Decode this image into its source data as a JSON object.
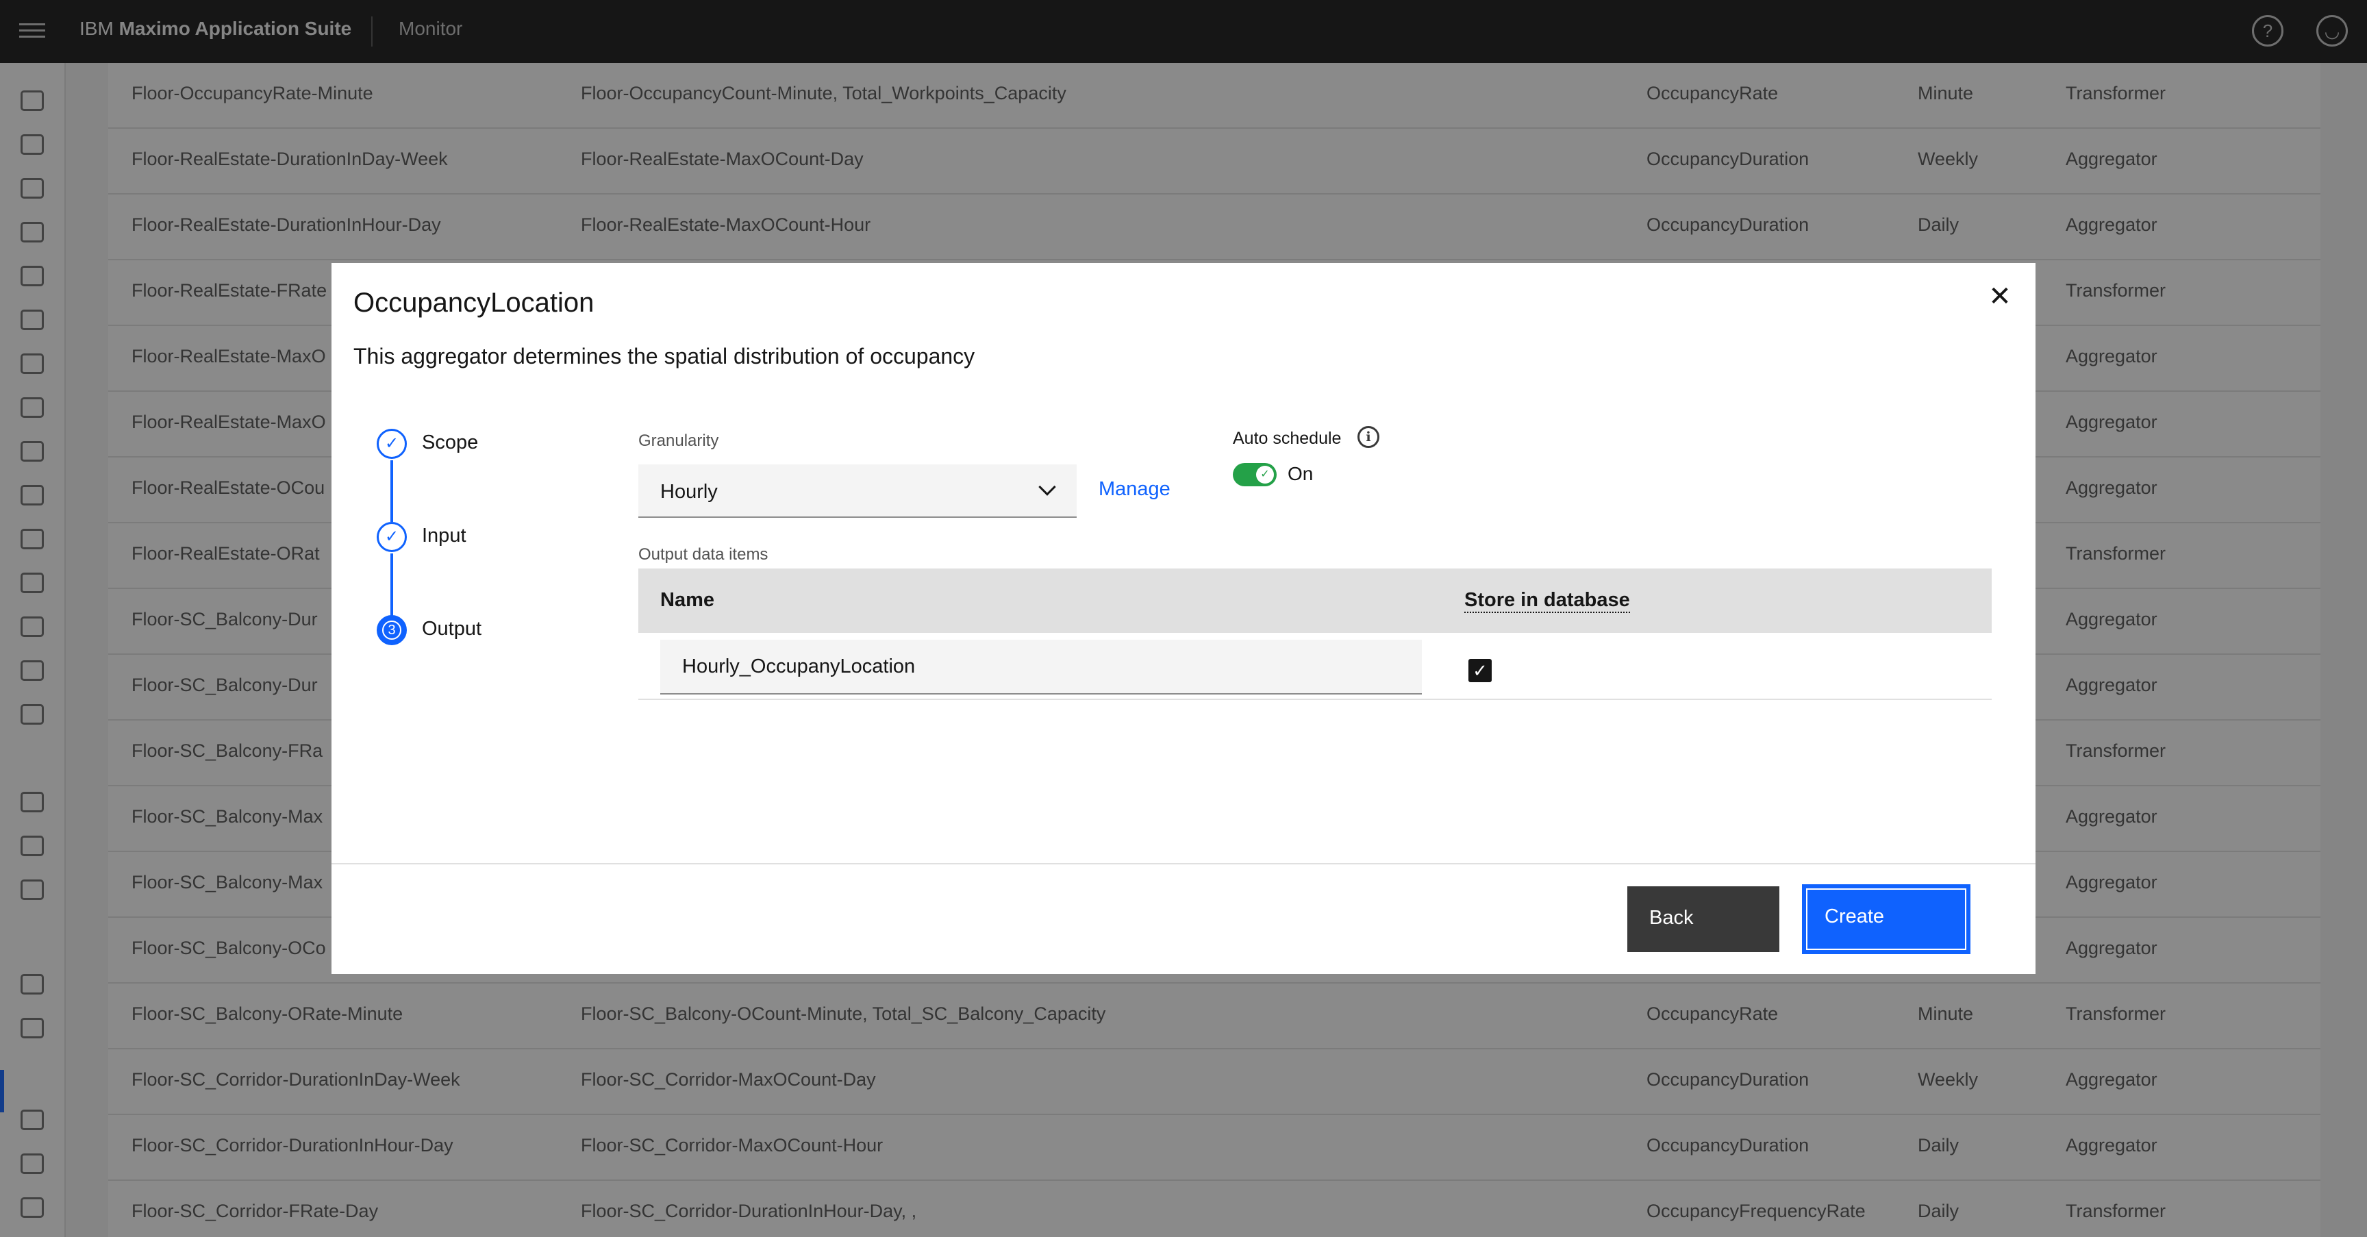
{
  "header": {
    "brand_prefix": "IBM ",
    "brand_name": "Maximo Application Suite",
    "app_name": "Monitor"
  },
  "background_rows": [
    [
      "Floor-OccupancyRate-Minute",
      "Floor-OccupancyCount-Minute, Total_Workpoints_Capacity",
      "OccupancyRate",
      "Minute",
      "Transformer"
    ],
    [
      "Floor-RealEstate-DurationInDay-Week",
      "Floor-RealEstate-MaxOCount-Day",
      "OccupancyDuration",
      "Weekly",
      "Aggregator"
    ],
    [
      "Floor-RealEstate-DurationInHour-Day",
      "Floor-RealEstate-MaxOCount-Hour",
      "OccupancyDuration",
      "Daily",
      "Aggregator"
    ],
    [
      "Floor-RealEstate-FRate",
      "",
      "",
      "",
      "Transformer"
    ],
    [
      "Floor-RealEstate-MaxO",
      "",
      "",
      "",
      "Aggregator"
    ],
    [
      "Floor-RealEstate-MaxO",
      "",
      "",
      "",
      "Aggregator"
    ],
    [
      "Floor-RealEstate-OCou",
      "",
      "",
      "",
      "Aggregator"
    ],
    [
      "Floor-RealEstate-ORat",
      "",
      "",
      "",
      "Transformer"
    ],
    [
      "Floor-SC_Balcony-Dur",
      "",
      "",
      "",
      "Aggregator"
    ],
    [
      "Floor-SC_Balcony-Dur",
      "",
      "",
      "",
      "Aggregator"
    ],
    [
      "Floor-SC_Balcony-FRa",
      "",
      "",
      "",
      "Transformer"
    ],
    [
      "Floor-SC_Balcony-Max",
      "",
      "",
      "",
      "Aggregator"
    ],
    [
      "Floor-SC_Balcony-Max",
      "",
      "",
      "",
      "Aggregator"
    ],
    [
      "Floor-SC_Balcony-OCo",
      "",
      "",
      "",
      "Aggregator"
    ],
    [
      "Floor-SC_Balcony-ORate-Minute",
      "Floor-SC_Balcony-OCount-Minute, Total_SC_Balcony_Capacity",
      "OccupancyRate",
      "Minute",
      "Transformer"
    ],
    [
      "Floor-SC_Corridor-DurationInDay-Week",
      "Floor-SC_Corridor-MaxOCount-Day",
      "OccupancyDuration",
      "Weekly",
      "Aggregator"
    ],
    [
      "Floor-SC_Corridor-DurationInHour-Day",
      "Floor-SC_Corridor-MaxOCount-Hour",
      "OccupancyDuration",
      "Daily",
      "Aggregator"
    ],
    [
      "Floor-SC_Corridor-FRate-Day",
      "Floor-SC_Corridor-DurationInHour-Day, ,",
      "OccupancyFrequencyRate",
      "Daily",
      "Transformer"
    ]
  ],
  "modal": {
    "title": "OccupancyLocation",
    "description": "This aggregator determines the spatial distribution of occupancy",
    "steps": [
      {
        "label": "Scope",
        "state": "complete"
      },
      {
        "label": "Input",
        "state": "complete"
      },
      {
        "label": "Output",
        "state": "current",
        "number": "3"
      }
    ],
    "granularity_label": "Granularity",
    "granularity_value": "Hourly",
    "manage_label": "Manage",
    "auto_schedule_label": "Auto schedule",
    "auto_schedule_state": "On",
    "output_label": "Output data items",
    "table_headers": {
      "name": "Name",
      "store": "Store in database"
    },
    "output_item_name": "Hourly_OccupanyLocation",
    "store_in_database": true,
    "back_label": "Back",
    "create_label": "Create"
  },
  "colors": {
    "primary": "#0f62fe",
    "toggle_on": "#24a148",
    "header": "#161616"
  }
}
